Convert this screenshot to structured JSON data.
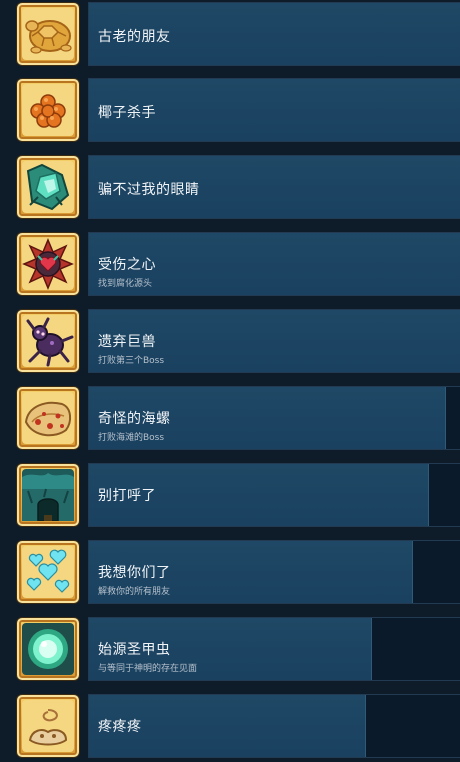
{
  "achievements": [
    {
      "title": "古老的朋友",
      "desc": "",
      "progress": 1.0,
      "icon": "turtle-shell-icon"
    },
    {
      "title": "椰子杀手",
      "desc": "",
      "progress": 1.0,
      "icon": "coconut-cluster-icon"
    },
    {
      "title": "骗不过我的眼睛",
      "desc": "",
      "progress": 1.0,
      "icon": "crystal-gem-icon"
    },
    {
      "title": "受伤之心",
      "desc": "找到腐化源头",
      "progress": 1.0,
      "icon": "corrupted-heart-icon"
    },
    {
      "title": "遗弃巨兽",
      "desc": "打败第三个Boss",
      "progress": 1.0,
      "icon": "spider-beast-icon"
    },
    {
      "title": "奇怪的海螺",
      "desc": "打败海滩的Boss",
      "progress": 0.96,
      "icon": "conch-shell-icon"
    },
    {
      "title": "别打呼了",
      "desc": "",
      "progress": 0.915,
      "icon": "cave-entrance-icon"
    },
    {
      "title": "我想你们了",
      "desc": "解救你的所有朋友",
      "progress": 0.87,
      "icon": "hearts-icon"
    },
    {
      "title": "始源圣甲虫",
      "desc": "与等同于神明的存在见面",
      "progress": 0.76,
      "icon": "scarab-orb-icon"
    },
    {
      "title": "疼疼疼",
      "desc": "",
      "progress": 0.745,
      "icon": "dizzy-spiral-icon"
    }
  ]
}
